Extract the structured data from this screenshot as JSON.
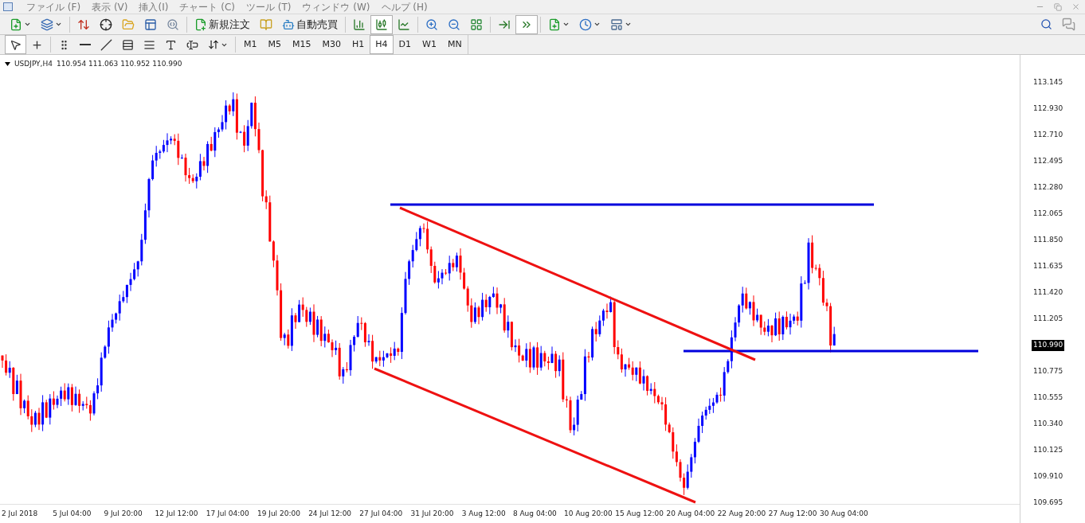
{
  "menu": [
    "ファイル (F)",
    "表示 (V)",
    "挿入(I)",
    "チャート (C)",
    "ツール (T)",
    "ウィンドウ (W)",
    "ヘルプ (H)"
  ],
  "toolbar": {
    "order_button": "新規注文",
    "autotrade_button": "自動売買",
    "chart_types": [
      {
        "kind": "bar",
        "selected": false
      },
      {
        "kind": "candle",
        "selected": true
      },
      {
        "kind": "line",
        "selected": false
      }
    ],
    "navigation": [
      {
        "kind": "autoscroll",
        "selected": false
      },
      {
        "kind": "shift",
        "selected": true
      }
    ]
  },
  "drawing_tools": [
    {
      "kind": "cursor",
      "selected": true
    },
    {
      "kind": "crosshair",
      "selected": false
    },
    {
      "kind": "vline",
      "selected": false
    },
    {
      "kind": "hline",
      "selected": false
    },
    {
      "kind": "trendline",
      "selected": false
    },
    {
      "kind": "channel",
      "selected": false
    },
    {
      "kind": "fibo",
      "selected": false
    },
    {
      "kind": "text",
      "selected": false
    },
    {
      "kind": "label",
      "selected": false
    }
  ],
  "timeframes": [
    {
      "label": "M1",
      "selected": false
    },
    {
      "label": "M5",
      "selected": false
    },
    {
      "label": "M15",
      "selected": false
    },
    {
      "label": "M30",
      "selected": false
    },
    {
      "label": "H1",
      "selected": false
    },
    {
      "label": "H4",
      "selected": true
    },
    {
      "label": "D1",
      "selected": false
    },
    {
      "label": "W1",
      "selected": false
    },
    {
      "label": "MN",
      "selected": false
    }
  ],
  "chart": {
    "symbol": "USDJPY,H4",
    "ohlc": "110.954 111.063 110.952 110.990",
    "price_axis": [
      {
        "label": "113.145",
        "kind": "tick"
      },
      {
        "label": "112.930",
        "kind": "tick"
      },
      {
        "label": "112.710",
        "kind": "tick"
      },
      {
        "label": "112.495",
        "kind": "tick"
      },
      {
        "label": "112.280",
        "kind": "tick"
      },
      {
        "label": "112.065",
        "kind": "tick"
      },
      {
        "label": "111.850",
        "kind": "tick"
      },
      {
        "label": "111.635",
        "kind": "tick"
      },
      {
        "label": "111.420",
        "kind": "tick"
      },
      {
        "label": "111.205",
        "kind": "tick"
      },
      {
        "label": "110.990",
        "kind": "current"
      },
      {
        "label": "110.775",
        "kind": "tick"
      },
      {
        "label": "110.555",
        "kind": "tick"
      },
      {
        "label": "110.340",
        "kind": "tick"
      },
      {
        "label": "110.125",
        "kind": "tick"
      },
      {
        "label": "109.910",
        "kind": "tick"
      },
      {
        "label": "109.695",
        "kind": "tick"
      }
    ],
    "time_axis": [
      "2 Jul 2018",
      "5 Jul 04:00",
      "9 Jul 20:00",
      "12 Jul 12:00",
      "17 Jul 04:00",
      "19 Jul 20:00",
      "24 Jul 12:00",
      "27 Jul 04:00",
      "31 Jul 20:00",
      "3 Aug 12:00",
      "8 Aug 04:00",
      "10 Aug 20:00",
      "15 Aug 12:00",
      "20 Aug 04:00",
      "22 Aug 20:00",
      "27 Aug 12:00",
      "30 Aug 04:00"
    ]
  }
}
